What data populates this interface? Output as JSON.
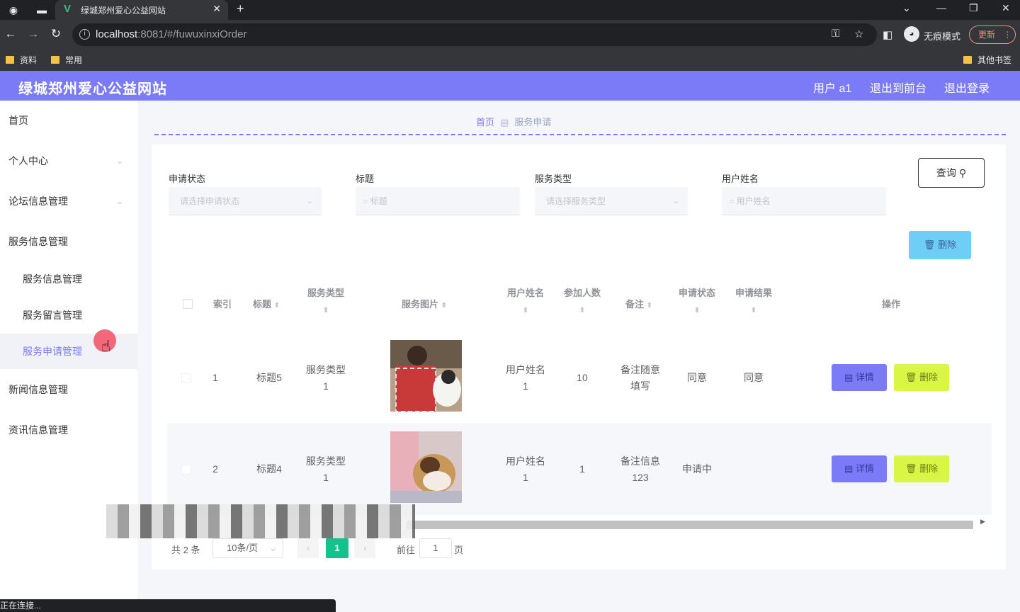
{
  "browser": {
    "tab_title": "绿城郑州爱心公益网站",
    "url_host": "localhost",
    "url_rest": ":8081/#/fuwuxinxiOrder",
    "incognito_label": "无痕模式",
    "update_label": "更新",
    "bookmarks": [
      "资料",
      "常用"
    ],
    "other_bookmarks": "其他书签",
    "status_text": "正在连接..."
  },
  "header": {
    "title": "绿城郑州爱心公益网站",
    "user": "用户 a1",
    "back_front": "退出到前台",
    "logout": "退出登录",
    "bg_color": "#7b7bf7"
  },
  "sidebar": {
    "items": [
      {
        "label": "首页"
      },
      {
        "label": "个人中心"
      },
      {
        "label": "论坛信息管理"
      },
      {
        "label": "服务信息管理"
      }
    ],
    "sub_items": [
      {
        "label": "服务信息管理"
      },
      {
        "label": "服务留言管理"
      },
      {
        "label": "服务申请管理"
      }
    ],
    "items_after": [
      {
        "label": "新闻信息管理"
      },
      {
        "label": "资讯信息管理"
      }
    ]
  },
  "breadcrumb": {
    "home": "首页",
    "current": "服务申请"
  },
  "filters": {
    "status_label": "申请状态",
    "status_placeholder": "请选择申请状态",
    "title_label": "标题",
    "title_placeholder": "标题",
    "type_label": "服务类型",
    "type_placeholder": "请选择服务类型",
    "user_label": "用户姓名",
    "user_placeholder": "用户姓名",
    "query_label": "查询"
  },
  "delete_label": "删除",
  "table": {
    "headers": {
      "index": "索引",
      "title": "标题",
      "service_type": "服务类型",
      "image": "服务图片",
      "user_name": "用户姓名",
      "participants": "参加人数",
      "remark": "备注",
      "status": "申请状态",
      "result": "申请结果",
      "actions": "操作"
    },
    "rows": [
      {
        "index": "1",
        "title": "标题5",
        "service_type_a": "服务类型",
        "service_type_b": "1",
        "user_a": "用户姓名",
        "user_b": "1",
        "participants": "10",
        "remark_a": "备注随意",
        "remark_b": "填写",
        "status": "同意",
        "result": "同意"
      },
      {
        "index": "2",
        "title": "标题4",
        "service_type_a": "服务类型",
        "service_type_b": "1",
        "user_a": "用户姓名",
        "user_b": "1",
        "participants": "1",
        "remark_a": "备注信息",
        "remark_b": "123",
        "status": "申请中",
        "result": ""
      }
    ],
    "detail_label": "详情",
    "delete_label": "删除"
  },
  "pagination": {
    "total": "共 2 条",
    "page_size": "10条/页",
    "current_page": "1",
    "goto": "前往",
    "goto_value": "1",
    "page_unit": "页"
  }
}
